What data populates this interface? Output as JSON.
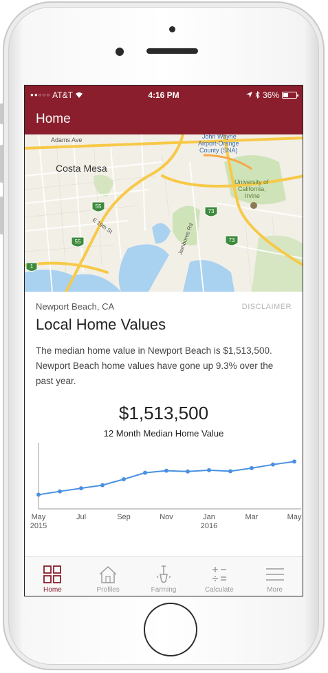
{
  "status_bar": {
    "carrier": "AT&T",
    "time": "4:16 PM",
    "battery": "36%"
  },
  "nav": {
    "title": "Home"
  },
  "map": {
    "labels": [
      "Adams Ave",
      "Costa Mesa",
      "John Wayne Airport-Orange County (SNA)",
      "University of California, Irvine",
      "E 19th St",
      "Jamboree Rd"
    ],
    "label_airport_1": "John Wayne",
    "label_airport_2": "Airport-Orange",
    "label_airport_3": "County (SNA)",
    "label_uci_1": "University of",
    "label_uci_2": "California,",
    "label_uci_3": "Irvine",
    "shields": [
      "55",
      "55",
      "73",
      "73",
      "1"
    ]
  },
  "content": {
    "location": "Newport Beach, CA",
    "disclaimer": "DISCLAIMER",
    "title": "Local Home Values",
    "description": "The median home value in Newport Beach is $1,513,500. Newport Beach home values have gone up 9.3% over the past year.",
    "median_value": "$1,513,500",
    "median_label": "12 Month Median Home Value"
  },
  "chart_data": {
    "type": "line",
    "x": [
      "May 2015",
      "Jun 2015",
      "Jul 2015",
      "Aug 2015",
      "Sep 2015",
      "Oct 2015",
      "Nov 2015",
      "Dec 2015",
      "Jan 2016",
      "Feb 2016",
      "Mar 2016",
      "Apr 2016",
      "May 2016"
    ],
    "values": [
      1385000,
      1398000,
      1410000,
      1422000,
      1445000,
      1470000,
      1478000,
      1475000,
      1480000,
      1476000,
      1488000,
      1502000,
      1513500
    ],
    "tick_labels": [
      {
        "line1": "May",
        "line2": "2015"
      },
      {
        "line1": "Jul",
        "line2": ""
      },
      {
        "line1": "Sep",
        "line2": ""
      },
      {
        "line1": "Nov",
        "line2": ""
      },
      {
        "line1": "Jan",
        "line2": "2016"
      },
      {
        "line1": "Mar",
        "line2": ""
      },
      {
        "line1": "May",
        "line2": ""
      }
    ],
    "ylim": [
      1330000,
      1560000
    ],
    "series_color": "#4a90e2",
    "grid": false
  },
  "tabs": [
    {
      "label": "Home",
      "icon": "grid-icon",
      "active": true
    },
    {
      "label": "Profiles",
      "icon": "house-icon",
      "active": false
    },
    {
      "label": "Farming",
      "icon": "shovel-icon",
      "active": false
    },
    {
      "label": "Calculate",
      "icon": "calculator-icon",
      "active": false
    },
    {
      "label": "More",
      "icon": "menu-icon",
      "active": false
    }
  ],
  "colors": {
    "brand": "#8a1e2c",
    "chart_line": "#4a90e2"
  }
}
